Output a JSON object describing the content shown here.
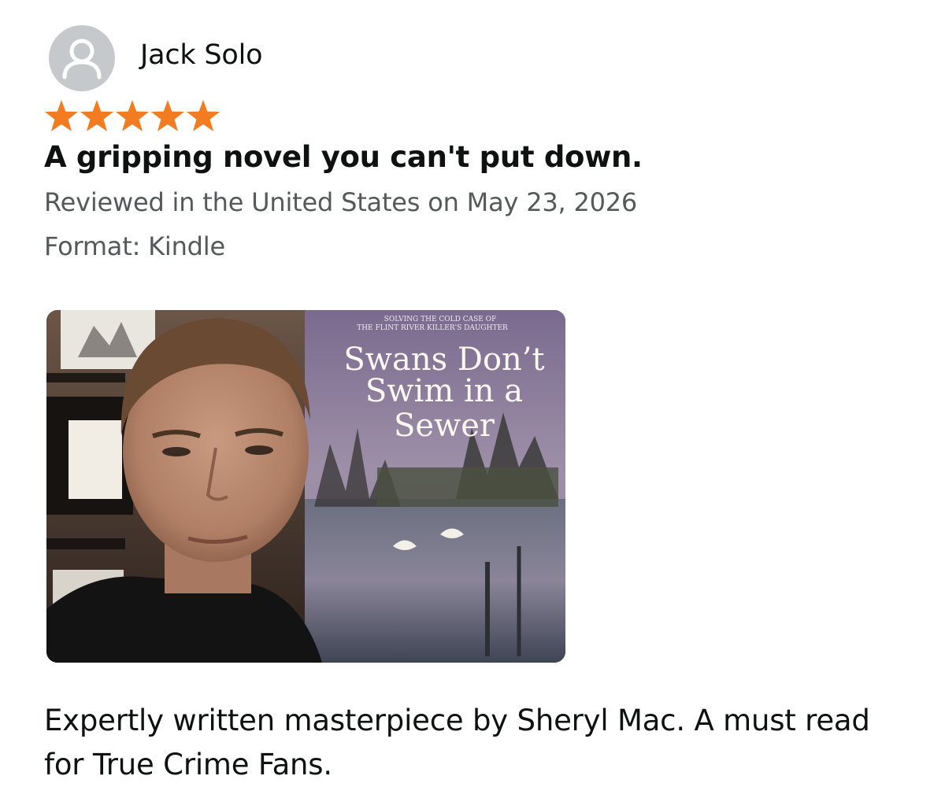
{
  "reviewer": {
    "name": "Jack Solo",
    "avatar_icon": "default-profile-icon"
  },
  "rating": {
    "stars": 5,
    "max_stars": 5,
    "star_color": "#f47c20"
  },
  "review": {
    "title": "A gripping novel you can't put down.",
    "date_line": "Reviewed in the United States on May 23, 2026",
    "format_line": "Format: Kindle",
    "body": "Expertly written masterpiece by Sheryl Mac. A must read for True Crime Fans."
  },
  "photo": {
    "book_subtitle_line1": "SOLVING THE COLD CASE OF",
    "book_subtitle_line2": "THE FLINT RIVER KILLER'S DAUGHTER",
    "book_title_line1": "Swans Don’t",
    "book_title_line2": "Swim in a",
    "book_title_line3": "Sewer"
  },
  "colors": {
    "text_primary": "#0f1111",
    "text_secondary": "#565959",
    "avatar_bg": "#c5c9cc"
  }
}
